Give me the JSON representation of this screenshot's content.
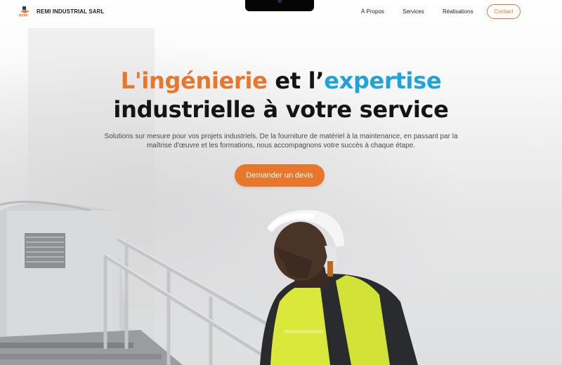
{
  "brand": {
    "name": "REMI INDUSTRIAL SARL",
    "logo_text": "REMI"
  },
  "nav": {
    "links": [
      "À Propos",
      "Services",
      "Réalisations"
    ],
    "contact_label": "Contact"
  },
  "hero": {
    "headline_part1": "L'ingénierie",
    "headline_part2": " et l’",
    "headline_part3": "expertise",
    "headline_line2": "industrielle à votre service",
    "subtitle_line1": "Solutions sur mesure pour vos projets industriels. De la fourniture de matériel à la maintenance, en passant par la",
    "subtitle_line2": "maîtrise d'œuvre et les formations, nous accompagnons votre succès à chaque étape.",
    "cta_label": "Demander un devis"
  },
  "colors": {
    "accent": "#e8762b",
    "secondary": "#1fa3db",
    "text": "#141414"
  },
  "icons": [
    "remi-logo-icon"
  ]
}
